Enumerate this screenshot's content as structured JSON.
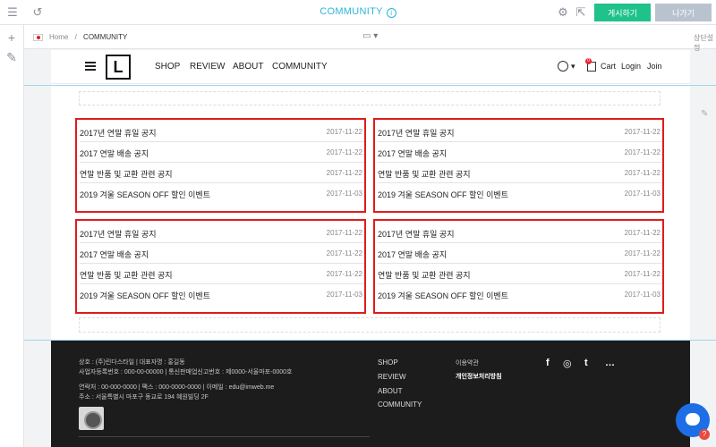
{
  "editor": {
    "title": "COMMUNITY",
    "info_icon": "i",
    "publish_label": "게시하기",
    "exit_label": "나가기",
    "breadcrumb_home": "Home",
    "breadcrumb_sep": "/",
    "breadcrumb_current": "COMMUNITY",
    "right_label": "상단설정"
  },
  "site": {
    "logo": "L",
    "menu": [
      "SHOP",
      "REVIEW",
      "ABOUT",
      "COMMUNITY"
    ],
    "cart_label": "Cart",
    "cart_count": "0",
    "login_label": "Login",
    "join_label": "Join"
  },
  "notices": {
    "boxes": [
      [
        {
          "title": "2017년 연말 휴일 공지",
          "date": "2017-11-22"
        },
        {
          "title": "2017 연말 배송 공지",
          "date": "2017-11-22"
        },
        {
          "title": "연말 반품 및 교환 관련 공지",
          "date": "2017-11-22"
        },
        {
          "title": "2019 겨울 SEASON OFF 할인 이벤트",
          "date": "2017-11-03"
        }
      ],
      [
        {
          "title": "2017년 연말 휴일 공지",
          "date": "2017-11-22"
        },
        {
          "title": "2017 연말 배송 공지",
          "date": "2017-11-22"
        },
        {
          "title": "연말 반품 및 교환 관련 공지",
          "date": "2017-11-22"
        },
        {
          "title": "2019 겨울 SEASON OFF 할인 이벤트",
          "date": "2017-11-03"
        }
      ],
      [
        {
          "title": "2017년 연말 휴일 공지",
          "date": "2017-11-22"
        },
        {
          "title": "2017 연말 배송 공지",
          "date": "2017-11-22"
        },
        {
          "title": "연말 반품 및 교환 관련 공지",
          "date": "2017-11-22"
        },
        {
          "title": "2019 겨울 SEASON OFF 할인 이벤트",
          "date": "2017-11-03"
        }
      ],
      [
        {
          "title": "2017년 연말 휴일 공지",
          "date": "2017-11-22"
        },
        {
          "title": "2017 연말 배송 공지",
          "date": "2017-11-22"
        },
        {
          "title": "연말 반품 및 교환 관련 공지",
          "date": "2017-11-22"
        },
        {
          "title": "2019 겨울 SEASON OFF 할인 이벤트",
          "date": "2017-11-03"
        }
      ]
    ]
  },
  "footer": {
    "company_line": "상호 : (주)린다스타일 | 대표자명 : 홍길동",
    "biz_line": "사업자등록번호 : 000-00-00000 | 통신판매업신고번호 : 제0000-서울마포-0000호",
    "contact_line": "연락처 : 00-000-0000 | 팩스 : 000-0000-0000 | 이메일 : edu@imweb.me",
    "address_line": "주소 : 서울특별시 마포구 동교로 194 혜원빌딩 2F",
    "links": [
      "SHOP",
      "REVIEW",
      "ABOUT",
      "COMMUNITY"
    ],
    "terms_label": "이용약관",
    "privacy_label": "개인정보처리방침",
    "social": [
      "f",
      "◎",
      "t",
      "…"
    ]
  },
  "colors": {
    "accent": "#2bb6d9",
    "publish": "#1fc28b",
    "highlight_border": "#e01b1b",
    "footer_bg": "#1c1c1c"
  }
}
